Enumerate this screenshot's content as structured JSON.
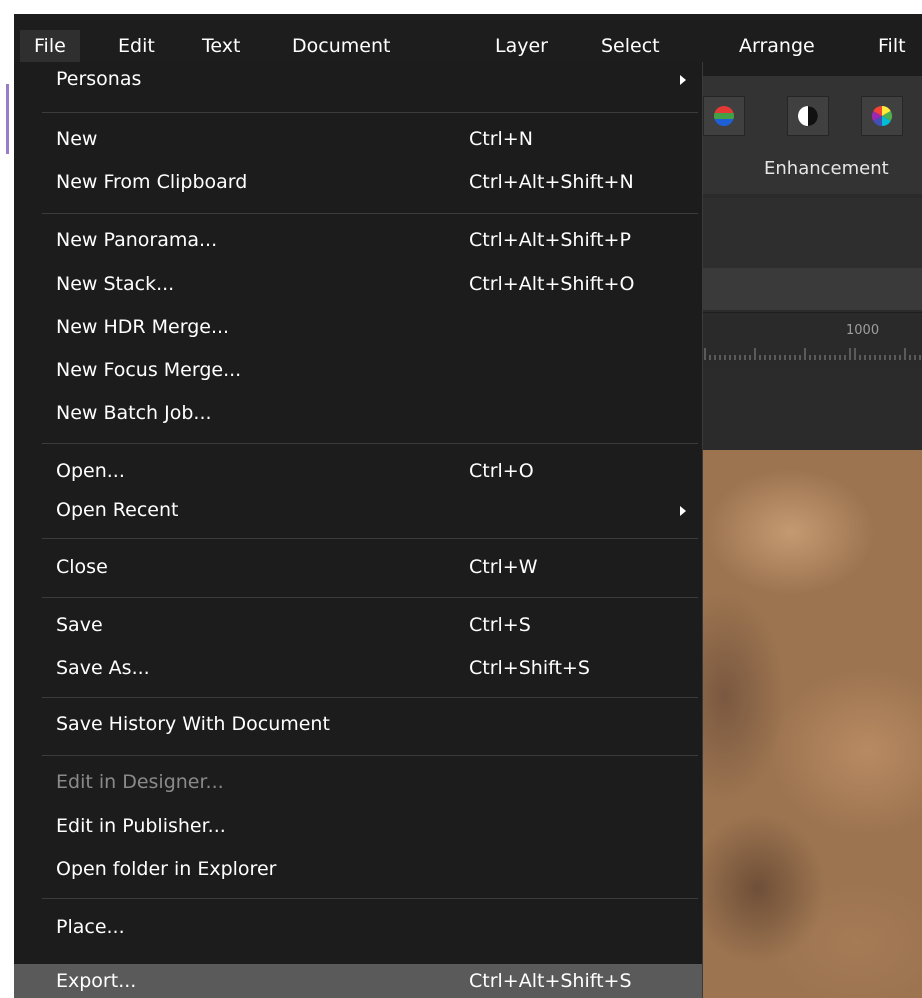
{
  "menubar": {
    "items": [
      "File",
      "Edit",
      "Text",
      "Document",
      "Layer",
      "Select",
      "Arrange",
      "Filt"
    ]
  },
  "toolbar": {
    "enhancements_label": "Enhancement",
    "icons": [
      "color-balance-icon",
      "black-white-icon",
      "hsl-icon"
    ]
  },
  "ruler": {
    "label": "1000"
  },
  "file_menu": {
    "items": [
      {
        "label": "Personas",
        "shortcut": "",
        "submenu": true,
        "disabled": false
      },
      {
        "label": "New",
        "shortcut": "Ctrl+N",
        "submenu": false,
        "disabled": false
      },
      {
        "label": "New From Clipboard",
        "shortcut": "Ctrl+Alt+Shift+N",
        "submenu": false,
        "disabled": false
      },
      {
        "label": "New Panorama...",
        "shortcut": "Ctrl+Alt+Shift+P",
        "submenu": false,
        "disabled": false
      },
      {
        "label": "New Stack...",
        "shortcut": "Ctrl+Alt+Shift+O",
        "submenu": false,
        "disabled": false
      },
      {
        "label": "New HDR Merge...",
        "shortcut": "",
        "submenu": false,
        "disabled": false
      },
      {
        "label": "New Focus Merge...",
        "shortcut": "",
        "submenu": false,
        "disabled": false
      },
      {
        "label": "New Batch Job...",
        "shortcut": "",
        "submenu": false,
        "disabled": false
      },
      {
        "label": "Open...",
        "shortcut": "Ctrl+O",
        "submenu": false,
        "disabled": false
      },
      {
        "label": "Open Recent",
        "shortcut": "",
        "submenu": true,
        "disabled": false
      },
      {
        "label": "Close",
        "shortcut": "Ctrl+W",
        "submenu": false,
        "disabled": false
      },
      {
        "label": "Save",
        "shortcut": "Ctrl+S",
        "submenu": false,
        "disabled": false
      },
      {
        "label": "Save As...",
        "shortcut": "Ctrl+Shift+S",
        "submenu": false,
        "disabled": false
      },
      {
        "label": "Save History With Document",
        "shortcut": "",
        "submenu": false,
        "disabled": false
      },
      {
        "label": "Edit in Designer...",
        "shortcut": "",
        "submenu": false,
        "disabled": true
      },
      {
        "label": "Edit in Publisher...",
        "shortcut": "",
        "submenu": false,
        "disabled": false
      },
      {
        "label": "Open folder in Explorer",
        "shortcut": "",
        "submenu": false,
        "disabled": false
      },
      {
        "label": "Place...",
        "shortcut": "",
        "submenu": false,
        "disabled": false
      },
      {
        "label": "Export...",
        "shortcut": "Ctrl+Alt+Shift+S",
        "submenu": false,
        "disabled": false,
        "highlighted": true
      }
    ]
  },
  "colors": {
    "menu_bg": "#1c1c1c",
    "menubar_bg": "#1d1d1d",
    "highlight": "#5a5a5a",
    "disabled_text": "#8a8a8a",
    "text": "#ffffff"
  }
}
